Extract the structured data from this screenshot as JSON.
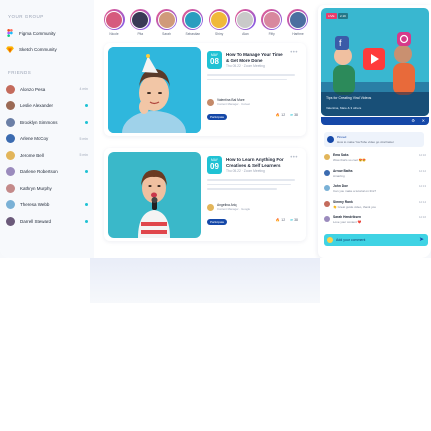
{
  "sidebar": {
    "groups_heading": "YOUR GROUP",
    "groups": [
      {
        "label": "Figma Community",
        "icon": "figma-icon",
        "color": "#ffffff"
      },
      {
        "label": "Sketch Community",
        "icon": "sketch-icon",
        "color": "#ffffff"
      }
    ],
    "friends_heading": "FRIENDS",
    "friends": [
      {
        "name": "Alonzo Pesa",
        "meta": "4 min",
        "color": "#c46b5c"
      },
      {
        "name": "Leslie Alexander",
        "meta": "",
        "color": "#9b6a55",
        "online": true
      },
      {
        "name": "Brooklyn Simmons",
        "meta": "",
        "color": "#6b7fa6",
        "online": true
      },
      {
        "name": "Arlene McCoy",
        "meta": "5 min",
        "color": "#3b6bb0"
      },
      {
        "name": "Jerome Bell",
        "meta": "5 min",
        "color": "#e2b55a"
      },
      {
        "name": "Darlene Robertson",
        "meta": "",
        "color": "#9b8bbd",
        "online": true
      },
      {
        "name": "Kathryn Murphy",
        "meta": "",
        "color": "#c48a8a"
      },
      {
        "name": "Theresa Webb",
        "meta": "",
        "color": "#7ab1d6",
        "online": true
      },
      {
        "name": "Darrell Steward",
        "meta": "",
        "color": "#6b5a7a",
        "online": true
      }
    ]
  },
  "stories": [
    {
      "name": "Nicole",
      "color": "#d65a7e"
    },
    {
      "name": "Pita",
      "color": "#3a3a55"
    },
    {
      "name": "Sarah",
      "color": "#d09a7a"
    },
    {
      "name": "Sebastian",
      "color": "#2a9dbf"
    },
    {
      "name": "Shiny",
      "color": "#f0b93a"
    },
    {
      "name": "Alan",
      "color": "#c9c9c9"
    },
    {
      "name": "Fifty",
      "color": "#d8879e"
    },
    {
      "name": "Haritme",
      "color": "#4b6fa0"
    }
  ],
  "events": [
    {
      "month": "MAY",
      "day": "08",
      "title": "How To Manage Your Time & Get More Done",
      "subtitle": "Thu 05.22 · Zoom Meeting",
      "host_name": "Valentina Bal Mure",
      "host_role": "Content Manager · Cozeet",
      "button": "Participate",
      "likes": "12",
      "shares": "38",
      "image_bg": "#2eb5db"
    },
    {
      "month": "MAY",
      "day": "09",
      "title": "How to Learn Anything For Creatives & Self Learners",
      "subtitle": "Thu 05.22 · Zoom Meeting",
      "host_name": "Angelina Ariq",
      "host_role": "Content Manager · Google",
      "button": "Participate",
      "likes": "12",
      "shares": "38",
      "image_bg": "#39b7c8"
    }
  ],
  "chat": {
    "live_label": "LIVE",
    "viewers": "2.1K",
    "caption": "Tips for Creating Viral Videos",
    "host": "Valentina, Mare & 3 others",
    "pinned_title": "Pinned",
    "pinned_text": "How to make YouTube video go viral faster",
    "comments": [
      {
        "name": "Ema Saks",
        "text": "Wow that's so cool 😍😍",
        "time": "12:10",
        "color": "#e2b55a"
      },
      {
        "name": "Arrow Baths",
        "text": "Amazing",
        "time": "12:12",
        "color": "#3b6bb0"
      },
      {
        "name": "John Doe",
        "text": "Can you make a tutorial on this?",
        "time": "12:13",
        "color": "#7ab1d6"
      },
      {
        "name": "Simmy Rank",
        "text": "👏 Great guide video, thank you",
        "time": "12:14",
        "color": "#c46b5c"
      },
      {
        "name": "Sarah Hendriksen",
        "text": "Love your content ❤️",
        "time": "12:16",
        "color": "#9b8bbd"
      }
    ],
    "input_placeholder": "Add your comment"
  },
  "colors": {
    "accent": "#1fc2d4",
    "primary": "#1548a8",
    "live": "#ea3b6a"
  }
}
